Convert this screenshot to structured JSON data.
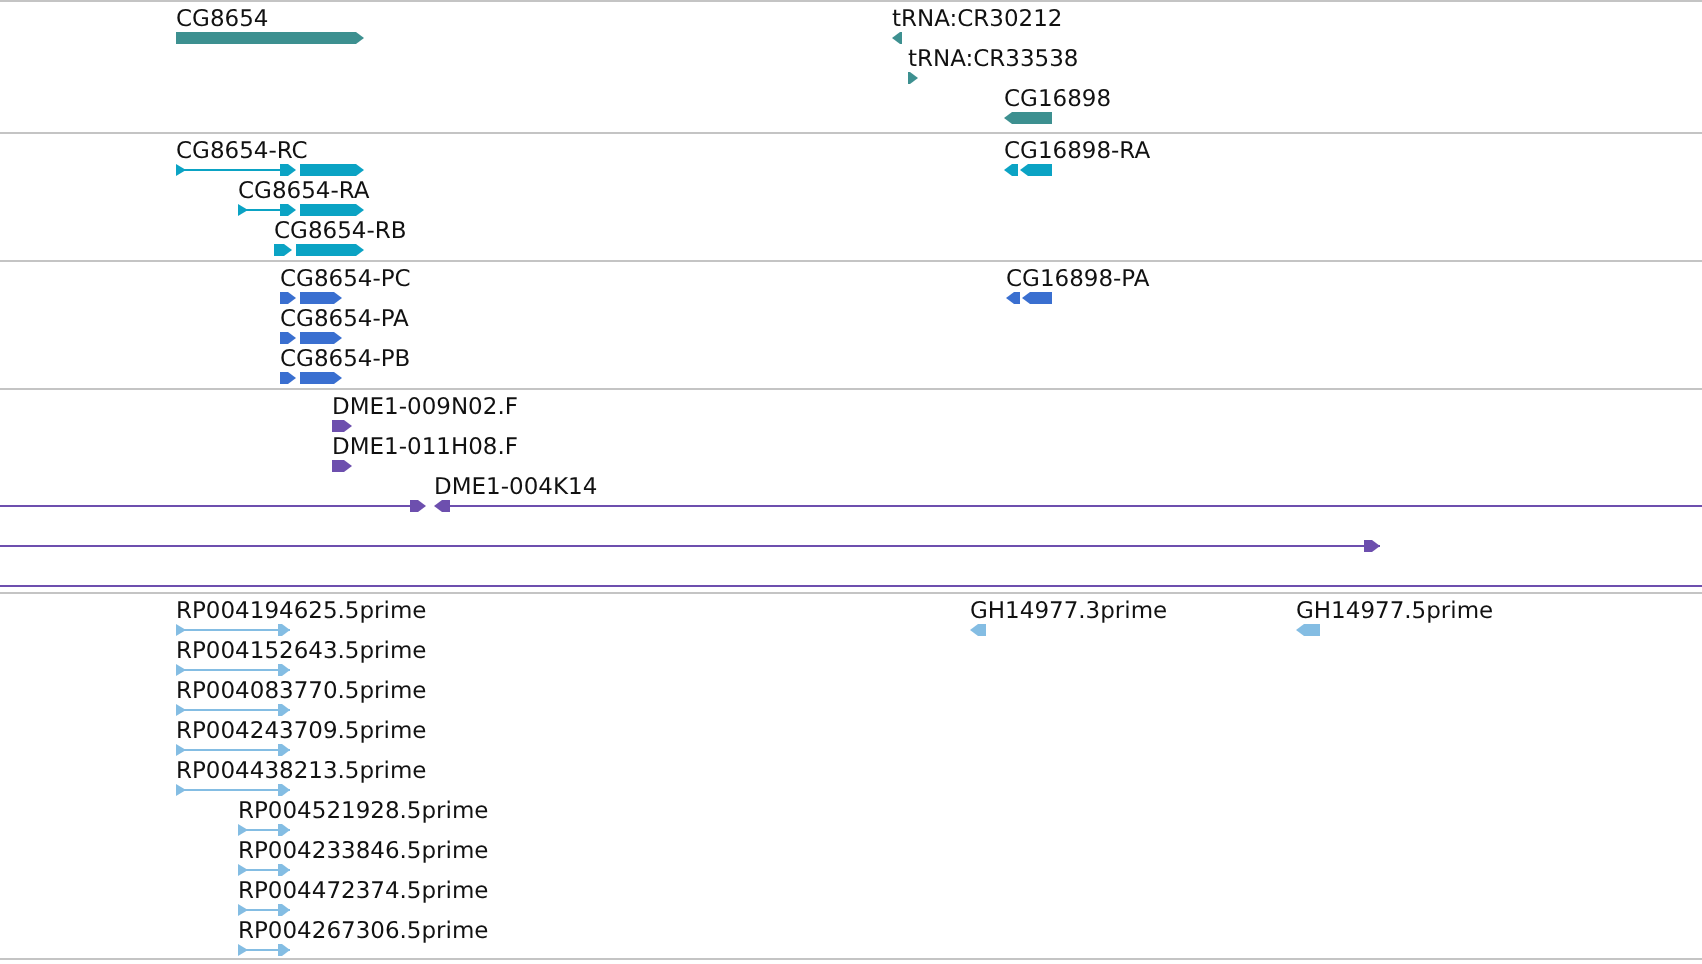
{
  "tracks": [
    {
      "color": "#3d9090",
      "features": [
        {
          "label": "CG8654",
          "kind": "block",
          "reverse": false
        },
        {
          "label": "tRNA:CR30212",
          "kind": "block",
          "reverse": true
        },
        {
          "label": "tRNA:CR33538",
          "kind": "block",
          "reverse": false
        },
        {
          "label": "CG16898",
          "kind": "block",
          "reverse": true
        }
      ]
    },
    {
      "color": "#0ba3c4",
      "features": [
        {
          "label": "CG8654-RC",
          "kind": "spliced",
          "reverse": false
        },
        {
          "label": "CG8654-RA",
          "kind": "spliced",
          "reverse": false
        },
        {
          "label": "CG8654-RB",
          "kind": "spliced",
          "reverse": false
        },
        {
          "label": "CG16898-RA",
          "kind": "spliced",
          "reverse": true
        }
      ]
    },
    {
      "color": "#3a6fd0",
      "features": [
        {
          "label": "CG8654-PC",
          "kind": "spliced",
          "reverse": false
        },
        {
          "label": "CG8654-PA",
          "kind": "spliced",
          "reverse": false
        },
        {
          "label": "CG8654-PB",
          "kind": "spliced",
          "reverse": false
        },
        {
          "label": "CG16898-PA",
          "kind": "spliced",
          "reverse": true
        }
      ]
    },
    {
      "color": "#6d4fae",
      "features": [
        {
          "label": "DME1-009N02.F",
          "kind": "block",
          "reverse": false
        },
        {
          "label": "DME1-011H08.F",
          "kind": "block",
          "reverse": false
        },
        {
          "label": "DME1-004K14",
          "kind": "pair",
          "reverse": false
        },
        {
          "kind": "span",
          "reverse": false
        },
        {
          "kind": "line"
        }
      ]
    },
    {
      "color": "#84bde3",
      "features": [
        {
          "label": "RP004194625.5prime",
          "kind": "read",
          "reverse": false
        },
        {
          "label": "RP004152643.5prime",
          "kind": "read",
          "reverse": false
        },
        {
          "label": "RP004083770.5prime",
          "kind": "read",
          "reverse": false
        },
        {
          "label": "RP004243709.5prime",
          "kind": "read",
          "reverse": false
        },
        {
          "label": "RP004438213.5prime",
          "kind": "read",
          "reverse": false
        },
        {
          "label": "RP004521928.5prime",
          "kind": "read",
          "reverse": false
        },
        {
          "label": "RP004233846.5prime",
          "kind": "read",
          "reverse": false
        },
        {
          "label": "RP004472374.5prime",
          "kind": "read",
          "reverse": false
        },
        {
          "label": "RP004267306.5prime",
          "kind": "read",
          "reverse": false
        },
        {
          "label": "GH14977.3prime",
          "kind": "block",
          "reverse": true
        },
        {
          "label": "GH14977.5prime",
          "kind": "block",
          "reverse": true
        }
      ]
    }
  ]
}
